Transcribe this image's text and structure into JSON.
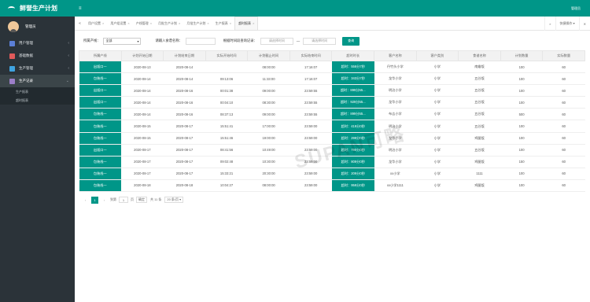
{
  "brand": {
    "title": "鲜誉生产计划"
  },
  "user": {
    "name": "管理员"
  },
  "sidebar": {
    "items": [
      {
        "label": "用户管理",
        "icon": "user-icon",
        "color": "#5b7fd6"
      },
      {
        "label": "基础数据",
        "icon": "data-icon",
        "color": "#e05a5a"
      },
      {
        "label": "生产管理",
        "icon": "wrench-icon",
        "color": "#3fa3e0"
      },
      {
        "label": "生产记录",
        "icon": "record-icon",
        "color": "#9b7ec8"
      }
    ],
    "submenu": [
      "生产报表",
      "超时报表"
    ]
  },
  "topbar": {
    "menu_icon": "≡",
    "admin": "管理员"
  },
  "tabs": [
    {
      "label": "用户设置"
    },
    {
      "label": "用户组设置"
    },
    {
      "label": "产线管理"
    },
    {
      "label": "月批生产计划"
    },
    {
      "label": "月批生产计划"
    },
    {
      "label": "生产报表"
    },
    {
      "label": "超时报表"
    }
  ],
  "tab_right": {
    "next": "»",
    "ops": "快捷操作 ▾",
    "close": "✕"
  },
  "filter": {
    "line_label": "所属产线：",
    "line_value": "全部",
    "product_label": "请输入食谱名称：",
    "range_label": "根据时间段查询记录：",
    "start_placeholder": "请选择时间",
    "sep": "—",
    "end_placeholder": "请选择时间",
    "search_button": "查询"
  },
  "table": {
    "headers": [
      "所属产线",
      "计划开始日期",
      "计划结束日期",
      "实际开始时间",
      "计划截止时间",
      "实际结束时间",
      "超时时长",
      "客户名称",
      "客户类别",
      "食谱名称",
      "计划数量",
      "实际数量"
    ],
    "rows": [
      [
        "出饭口一",
        "2020-08-13",
        "2020-08-14",
        "",
        "08:00:00",
        "17:16:07",
        "超时：556分7秒",
        "丹竹头小学",
        "小学",
        "南瓣饭",
        "100",
        "60"
      ],
      [
        "包装线一",
        "2020-08-14",
        "2020-08-14",
        "09:13:06",
        "11:33:00",
        "17:16:07",
        "超时：343分7秒",
        "龙华小学",
        "小学",
        "五谷饭",
        "100",
        "60"
      ],
      [
        "出饭口一",
        "2020-08-14",
        "2020-08-16",
        "00:01:38",
        "09:00:00",
        "23:59:55",
        "超时：899分55...",
        "明治小学",
        "小学",
        "五谷饭",
        "100",
        "60"
      ],
      [
        "出饭口一",
        "2020-08-14",
        "2020-08-16",
        "00:04:10",
        "08:30:00",
        "23:59:55",
        "超时：929分55...",
        "龙华小学",
        "小学",
        "五谷饭",
        "100",
        "60"
      ],
      [
        "包装线一",
        "2020-08-14",
        "2020-08-16",
        "08:37:13",
        "09:00:00",
        "23:59:55",
        "超时：899分55...",
        "布吉小学",
        "小学",
        "五谷饭",
        "500",
        "60"
      ],
      [
        "包装线一",
        "2020-08-15",
        "2020-08-17",
        "15:51:41",
        "17:00:00",
        "23:59:00",
        "超时：419分0秒",
        "明治小学",
        "小学",
        "五谷饭",
        "100",
        "60"
      ],
      [
        "包装线一",
        "2020-08-15",
        "2020-08-17",
        "15:51:46",
        "19:00:00",
        "23:59:00",
        "超时：299分0秒",
        "龙华小学",
        "小学",
        "鸡腿饭",
        "100",
        "60"
      ],
      [
        "出饭口一",
        "2020-08-17",
        "2020-08-17",
        "08:41:56",
        "10:49:00",
        "23:59:00",
        "超时：790分0秒",
        "明治小学",
        "小学",
        "五谷饭",
        "100",
        "60"
      ],
      [
        "包装线一",
        "2020-08-17",
        "2020-08-17",
        "09:02:48",
        "10:30:00",
        "23:59:00",
        "超时：809分0秒",
        "龙华小学",
        "小学",
        "鸡腿饭",
        "150",
        "60"
      ],
      [
        "包装线一",
        "2020-08-17",
        "2020-08-17",
        "15:33:21",
        "20:30:00",
        "23:59:00",
        "超时：209分0秒",
        "xx小学",
        "小学",
        "1111",
        "100",
        "60"
      ],
      [
        "包装线一",
        "2020-08-18",
        "2020-08-18",
        "10:04:27",
        "08:00:00",
        "23:59:00",
        "超时：959分0秒",
        "xx小学1111",
        "小学",
        "鸡腿饭",
        "100",
        "60"
      ]
    ]
  },
  "pager": {
    "prev": "‹",
    "current": "1",
    "next": "›",
    "goto": "到第",
    "page_value": "1",
    "page_unit": "页",
    "ok": "确定",
    "total": "共 11 条",
    "size": "20 条/页 ▾"
  },
  "watermark": "SUPAN可略"
}
